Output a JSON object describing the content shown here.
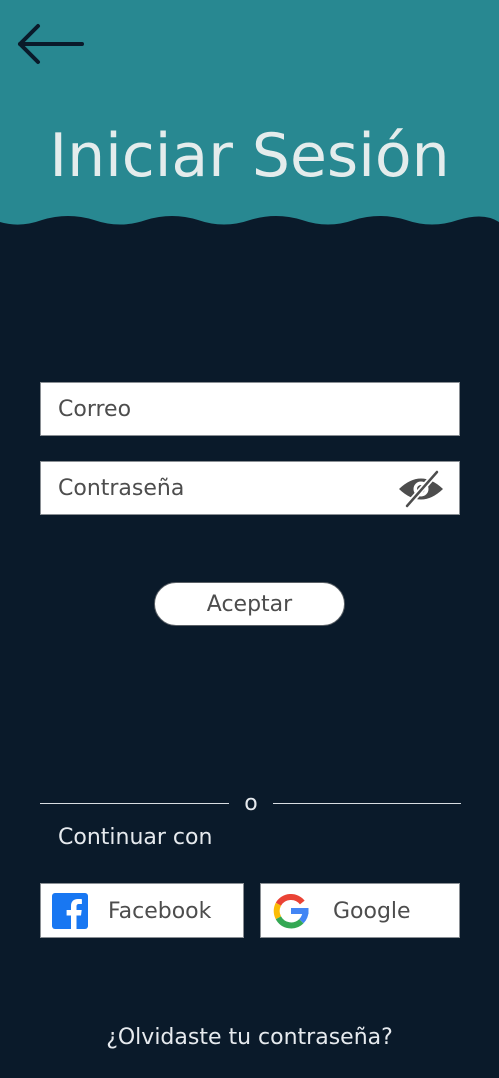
{
  "colors": {
    "header_bg": "#288891",
    "page_bg": "#0a1a2a",
    "title_text": "#e4ecec",
    "light_text": "#e6eaee",
    "field_text": "#4d4d4d",
    "facebook_blue": "#1877f2"
  },
  "header": {
    "back_icon": "arrow-left-icon",
    "title": "Iniciar Sesión"
  },
  "form": {
    "email": {
      "value": "",
      "placeholder": "Correo"
    },
    "password": {
      "value": "",
      "placeholder": "Contraseña",
      "toggle_icon": "eye-off-icon"
    },
    "accept_label": "Aceptar"
  },
  "social": {
    "divider_text": "o",
    "continue_label": "Continuar con",
    "facebook": {
      "label": "Facebook",
      "icon": "facebook-icon"
    },
    "google": {
      "label": "Google",
      "icon": "google-icon"
    }
  },
  "footer": {
    "forgot_password": "¿Olvidaste tu contraseña?"
  }
}
